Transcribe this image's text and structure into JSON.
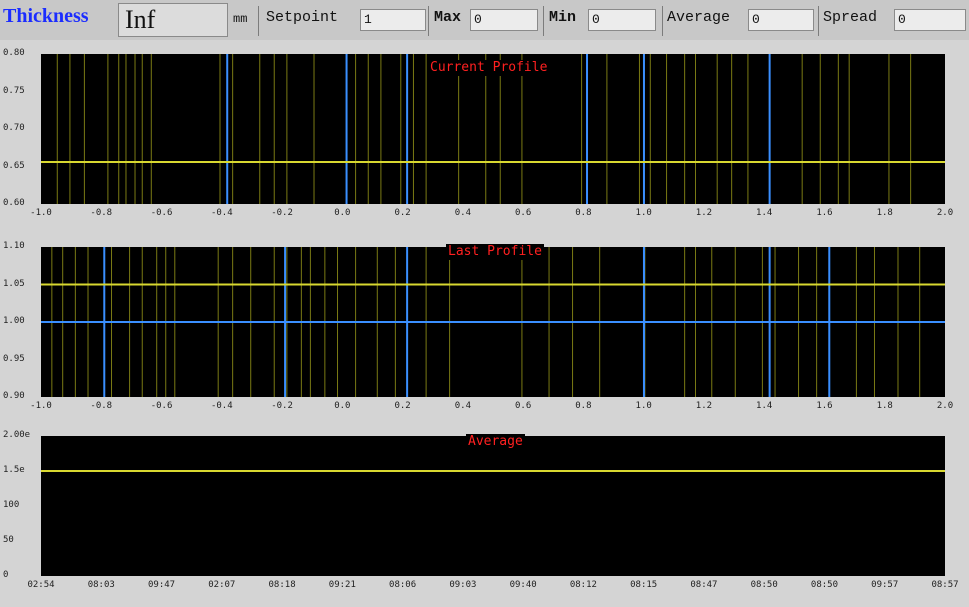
{
  "topbar": {
    "thickness_label": "Thickness",
    "thickness_value": "Inf",
    "thickness_unit": "mm",
    "setpoint_label": "Setpoint",
    "setpoint_value": "1",
    "max_label": "Max",
    "max_value": "0",
    "min_label": "Min",
    "min_value": "0",
    "average_label": "Average",
    "average_value": "0",
    "spread_label": "Spread",
    "spread_value": "0"
  },
  "colors": {
    "background": "#d4d4d4",
    "plot_bg": "#000000",
    "yellow": "#d8d830",
    "olive": "#7a7a14",
    "blue": "#3a8fff",
    "title_red": "#ff2020"
  },
  "chart_data": [
    {
      "type": "line",
      "title": "Current Profile",
      "x_tick_labels": [
        "-1.0",
        "-0.8",
        "-0.6",
        "-0.4",
        "-0.2",
        "0.0",
        "0.2",
        "0.4",
        "0.6",
        "0.8",
        "1.0",
        "1.2",
        "1.4",
        "1.6",
        "1.8",
        "2.0"
      ],
      "y_tick_labels": [
        "0.60",
        "0.65",
        "0.70",
        "0.75",
        "0.80"
      ],
      "series": [
        {
          "color": "yellow",
          "y_fraction": 0.28
        }
      ],
      "olive_lines": [
        0.018,
        0.032,
        0.048,
        0.074,
        0.086,
        0.094,
        0.104,
        0.112,
        0.122,
        0.198,
        0.212,
        0.242,
        0.258,
        0.272,
        0.302,
        0.348,
        0.362,
        0.376,
        0.398,
        0.412,
        0.426,
        0.462,
        0.492,
        0.508,
        0.532,
        0.598,
        0.626,
        0.662,
        0.674,
        0.692,
        0.712,
        0.724,
        0.748,
        0.764,
        0.782,
        0.842,
        0.862,
        0.882,
        0.894,
        0.938,
        0.962
      ],
      "blue_lines": [
        0.206,
        0.338,
        0.405,
        0.604,
        0.667,
        0.806
      ]
    },
    {
      "type": "line",
      "title": "Last Profile",
      "x_tick_labels": [
        "-1.0",
        "-0.8",
        "-0.6",
        "-0.4",
        "-0.2",
        "0.0",
        "0.2",
        "0.4",
        "0.6",
        "0.8",
        "1.0",
        "1.2",
        "1.4",
        "1.6",
        "1.8",
        "2.0"
      ],
      "y_tick_labels": [
        "0.90",
        "0.95",
        "1.00",
        "1.05",
        "1.10"
      ],
      "series": [
        {
          "color": "yellow",
          "y_fraction": 0.75
        },
        {
          "color": "blue",
          "y_fraction": 0.5
        }
      ],
      "olive_lines": [
        0.012,
        0.024,
        0.038,
        0.052,
        0.078,
        0.098,
        0.112,
        0.128,
        0.138,
        0.148,
        0.196,
        0.212,
        0.232,
        0.258,
        0.272,
        0.288,
        0.298,
        0.314,
        0.328,
        0.348,
        0.372,
        0.392,
        0.426,
        0.452,
        0.532,
        0.562,
        0.588,
        0.618,
        0.668,
        0.712,
        0.724,
        0.742,
        0.768,
        0.798,
        0.812,
        0.838,
        0.858,
        0.872,
        0.902,
        0.922,
        0.948,
        0.972
      ],
      "blue_lines": [
        0.07,
        0.27,
        0.405,
        0.667,
        0.806,
        0.872
      ]
    },
    {
      "type": "line",
      "title": "Average",
      "x_tick_labels": [
        "02:54",
        "08:03",
        "09:47",
        "02:07",
        "08:18",
        "09:21",
        "08:06",
        "09:03",
        "09:40",
        "08:12",
        "08:15",
        "08:47",
        "08:50",
        "08:50",
        "09:57",
        "08:57"
      ],
      "y_tick_labels": [
        "0",
        "50",
        "100",
        "1.5e",
        "2.00e"
      ],
      "series": [
        {
          "color": "yellow",
          "y_fraction": 0.75
        }
      ],
      "olive_lines": [],
      "blue_lines": []
    }
  ]
}
